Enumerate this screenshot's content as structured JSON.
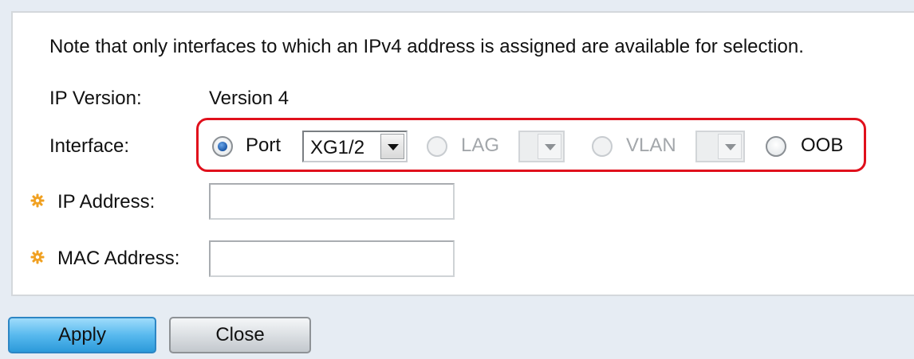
{
  "note": "Note that only interfaces to which an IPv4 address is assigned are available for selection.",
  "ip_version": {
    "label": "IP Version:",
    "value": "Version 4"
  },
  "interface": {
    "label": "Interface:",
    "options": {
      "port": {
        "label": "Port",
        "selected": true,
        "select_value": "XG1/2"
      },
      "lag": {
        "label": "LAG",
        "disabled": true,
        "select_value": ""
      },
      "vlan": {
        "label": "VLAN",
        "disabled": true,
        "select_value": ""
      },
      "oob": {
        "label": "OOB"
      }
    }
  },
  "ip_address": {
    "label": "IP Address:",
    "value": "",
    "required_icon": "gear-asterisk-icon"
  },
  "mac_address": {
    "label": "MAC Address:",
    "value": "",
    "required_icon": "gear-asterisk-icon"
  },
  "buttons": {
    "apply": "Apply",
    "close": "Close"
  },
  "colors": {
    "highlight": "#e0101c",
    "apply_button": "#58b9ee",
    "required_icon": "#f0a020"
  }
}
